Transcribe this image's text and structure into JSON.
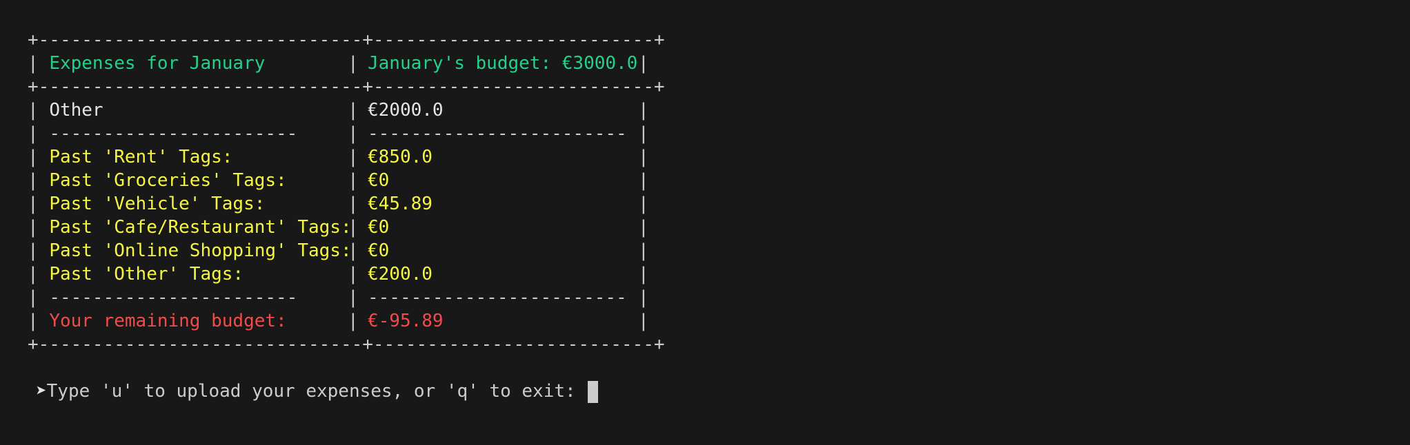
{
  "table": {
    "border_top": "+------------------------------+--------------------------+",
    "header": {
      "left": "Expenses for January",
      "right": "January's budget: €3000.0"
    },
    "border_mid": "+------------------------------+--------------------------+",
    "category_row": {
      "left": "Other",
      "right": "€2000.0"
    },
    "separator": {
      "left": "-----------------------",
      "right": "------------------------"
    },
    "tag_rows": [
      {
        "left": "Past 'Rent' Tags:",
        "right": "€850.0"
      },
      {
        "left": "Past 'Groceries' Tags:",
        "right": "€0"
      },
      {
        "left": "Past 'Vehicle' Tags:",
        "right": "€45.89"
      },
      {
        "left": "Past 'Cafe/Restaurant' Tags:",
        "right": "€0"
      },
      {
        "left": "Past 'Online Shopping' Tags:",
        "right": "€0"
      },
      {
        "left": "Past 'Other' Tags:",
        "right": "€200.0"
      }
    ],
    "remaining_row": {
      "left": "Your remaining budget:",
      "right": "€-95.89"
    },
    "border_bottom": "+------------------------------+--------------------------+"
  },
  "prompt": {
    "arrow": "➤",
    "text": "Type 'u' to upload your expenses, or 'q' to exit: "
  },
  "colors": {
    "background": "#181818",
    "header": "#23d18b",
    "tags": "#f5f543",
    "remaining": "#f14c4c",
    "text": "#e5e5e5"
  }
}
